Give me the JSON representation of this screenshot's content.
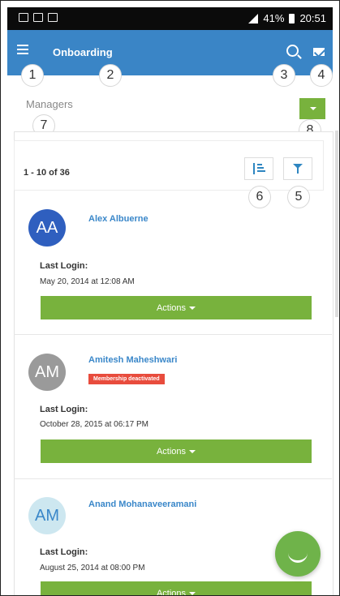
{
  "statusbar": {
    "battery": "41%",
    "time": "20:51"
  },
  "appbar": {
    "title": "Onboarding"
  },
  "markers": {
    "m1": "1",
    "m2": "2",
    "m3": "3",
    "m4": "4",
    "m5": "5",
    "m6": "6",
    "m7": "7",
    "m8": "8"
  },
  "page": {
    "label": "Managers",
    "range": "1 - 10 of 36"
  },
  "users": [
    {
      "initials": "AA",
      "name": "Alex Albuerne",
      "status": "",
      "last_login_label": "Last Login:",
      "last_login": "May 20, 2014 at 12:08 AM",
      "actions": "Actions"
    },
    {
      "initials": "AM",
      "name": "Amitesh Maheshwari",
      "status": "Membership deactivated",
      "last_login_label": "Last Login:",
      "last_login": "October 28, 2015 at 06:17 PM",
      "actions": "Actions"
    },
    {
      "initials": "AM",
      "name": "Anand Mohanaveeramani",
      "status": "",
      "last_login_label": "Last Login:",
      "last_login": "August 25, 2014 at 08:00 PM",
      "actions": "Actions"
    }
  ],
  "colors": {
    "primary": "#3a85c6",
    "accent": "#78b23d",
    "danger": "#e84c3d",
    "avatar_1": "#2f5fbf",
    "avatar_2": "#9a9a9a",
    "avatar_3": "#cde7f0"
  }
}
